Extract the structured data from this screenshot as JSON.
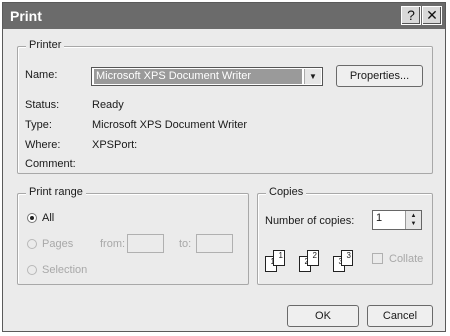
{
  "window": {
    "title": "Print",
    "help_label": "?",
    "close_label": "✕"
  },
  "printer": {
    "group_label": "Printer",
    "name_label": "Name:",
    "name_value": "Microsoft XPS Document Writer",
    "properties_label": "Properties...",
    "status_label": "Status:",
    "status_value": "Ready",
    "type_label": "Type:",
    "type_value": "Microsoft XPS Document Writer",
    "where_label": "Where:",
    "where_value": "XPSPort:",
    "comment_label": "Comment:",
    "comment_value": ""
  },
  "print_range": {
    "group_label": "Print range",
    "all_label": "All",
    "pages_label": "Pages",
    "from_label": "from:",
    "to_label": "to:",
    "selection_label": "Selection",
    "selected": "All"
  },
  "copies": {
    "group_label": "Copies",
    "number_label": "Number of copies:",
    "number_value": "1",
    "collate_label": "Collate",
    "collate_checked": false,
    "collate_pages": [
      "1",
      "1",
      "2",
      "2",
      "3",
      "3"
    ]
  },
  "buttons": {
    "ok_label": "OK",
    "cancel_label": "Cancel"
  }
}
